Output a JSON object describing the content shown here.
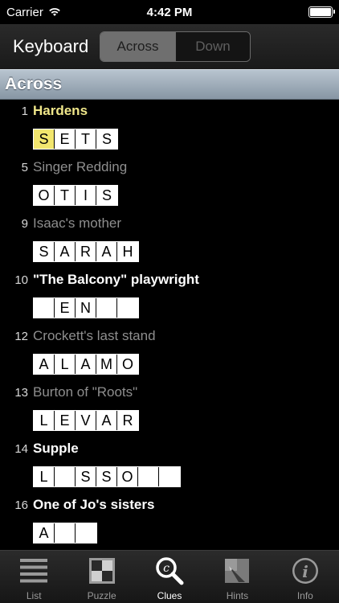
{
  "status_bar": {
    "carrier": "Carrier",
    "time": "4:42 PM",
    "battery_level": 1.0
  },
  "header": {
    "title": "Keyboard",
    "segments": [
      {
        "label": "Across",
        "active": true
      },
      {
        "label": "Down",
        "active": false
      }
    ]
  },
  "section": {
    "title": "Across"
  },
  "clues": [
    {
      "number": "1",
      "text": "Hardens",
      "state": "current",
      "cells": [
        "S",
        "E",
        "T",
        "S"
      ],
      "highlight": 0
    },
    {
      "number": "5",
      "text": "Singer Redding",
      "state": "solved",
      "cells": [
        "O",
        "T",
        "I",
        "S"
      ],
      "highlight": -1
    },
    {
      "number": "9",
      "text": "Isaac's mother",
      "state": "solved",
      "cells": [
        "S",
        "A",
        "R",
        "A",
        "H"
      ],
      "highlight": -1
    },
    {
      "number": "10",
      "text": "\"The Balcony\" playwright",
      "state": "unsolved",
      "cells": [
        "",
        "E",
        "N",
        "",
        ""
      ],
      "highlight": -1
    },
    {
      "number": "12",
      "text": "Crockett's last stand",
      "state": "solved",
      "cells": [
        "A",
        "L",
        "A",
        "M",
        "O"
      ],
      "highlight": -1
    },
    {
      "number": "13",
      "text": "Burton of \"Roots\"",
      "state": "solved",
      "cells": [
        "L",
        "E",
        "V",
        "A",
        "R"
      ],
      "highlight": -1
    },
    {
      "number": "14",
      "text": "Supple",
      "state": "unsolved",
      "cells": [
        "L",
        "",
        "S",
        "S",
        "O",
        "",
        ""
      ],
      "highlight": -1
    },
    {
      "number": "16",
      "text": "One of Jo's sisters",
      "state": "unsolved",
      "cells": [
        "A",
        "",
        ""
      ],
      "highlight": -1
    }
  ],
  "tabbar": {
    "tabs": [
      {
        "label": "List",
        "icon": "list-icon",
        "active": false
      },
      {
        "label": "Puzzle",
        "icon": "puzzle-grid-icon",
        "active": false
      },
      {
        "label": "Clues",
        "icon": "clues-magnifier-icon",
        "active": true
      },
      {
        "label": "Hints",
        "icon": "hints-icon",
        "active": false
      },
      {
        "label": "Info",
        "icon": "info-icon",
        "active": false
      }
    ]
  }
}
